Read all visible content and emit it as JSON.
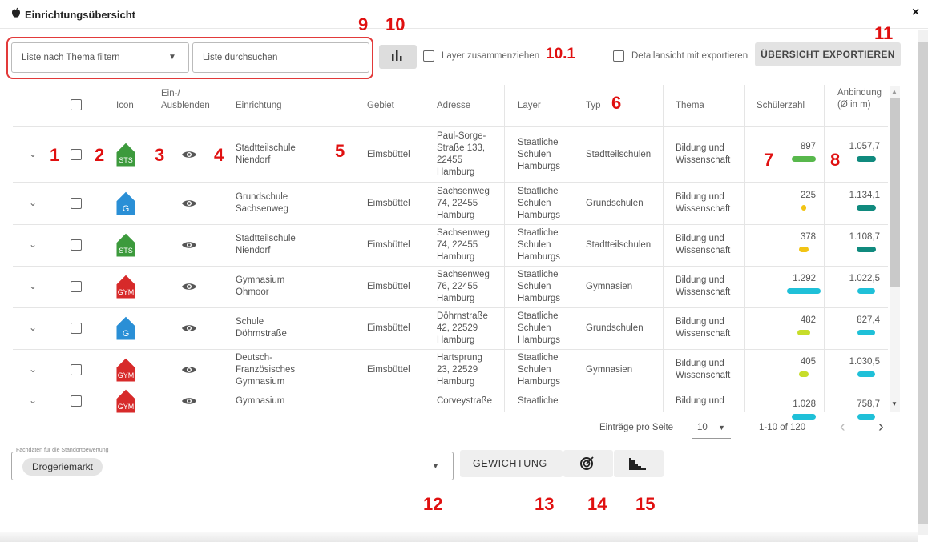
{
  "window": {
    "title": "Einrichtungsübersicht",
    "close_label": "×"
  },
  "toolbar": {
    "filter_placeholder": "Liste nach Thema filtern",
    "search_placeholder": "Liste durchsuchen",
    "merge_layers_label": "Layer zusammenziehen",
    "detail_export_label": "Detailansicht mit exportieren",
    "export_button": "ÜBERSICHT EXPORTIEREN"
  },
  "annotations": [
    "1",
    "2",
    "3",
    "4",
    "5",
    "6",
    "7",
    "8",
    "9",
    "10",
    "10.1",
    "11",
    "12",
    "13",
    "14",
    "15"
  ],
  "table": {
    "headers": {
      "icon": "Icon",
      "toggle": [
        "Ein-/",
        "Ausblenden"
      ],
      "facility": "Einrichtung",
      "area": "Gebiet",
      "address": "Adresse",
      "layer": "Layer",
      "type": "Typ",
      "topic": "Thema",
      "students": "Schülerzahl",
      "connection": [
        "Anbindung",
        "(Ø in m)"
      ]
    },
    "rows": [
      {
        "badge": "STS",
        "badge_color": "#3c9a3c",
        "name": [
          "Stadtteilschule",
          "Niendorf"
        ],
        "area": "Eimsbüttel",
        "address": [
          "Paul-Sorge-",
          "Straße 133,",
          "22455",
          "Hamburg"
        ],
        "layer": [
          "Staatliche",
          "Schulen",
          "Hamburgs"
        ],
        "type": "Stadtteilschulen",
        "topic": [
          "Bildung und",
          "Wissenschaft"
        ],
        "students": "897",
        "students_color": "#58b84c",
        "students_width": 30,
        "connection": "1.057,7",
        "connection_color": "#108a7e",
        "connection_width": 24
      },
      {
        "badge": "G",
        "badge_color": "#2a8fd6",
        "name": [
          "Grundschule",
          "Sachsenweg"
        ],
        "area": "Eimsbüttel",
        "address": [
          "Sachsenweg",
          "74, 22455",
          "Hamburg"
        ],
        "layer": [
          "Staatliche",
          "Schulen",
          "Hamburgs"
        ],
        "type": "Grundschulen",
        "topic": [
          "Bildung und",
          "Wissenschaft"
        ],
        "students": "225",
        "students_color": "#f2c414",
        "students_width": 6,
        "connection": "1.134,1",
        "connection_color": "#108a7e",
        "connection_width": 24
      },
      {
        "badge": "STS",
        "badge_color": "#3c9a3c",
        "name": [
          "Stadtteilschule",
          "Niendorf"
        ],
        "area": "Eimsbüttel",
        "address": [
          "Sachsenweg",
          "74, 22455",
          "Hamburg"
        ],
        "layer": [
          "Staatliche",
          "Schulen",
          "Hamburgs"
        ],
        "type": "Stadtteilschulen",
        "topic": [
          "Bildung und",
          "Wissenschaft"
        ],
        "students": "378",
        "students_color": "#f2c414",
        "students_width": 12,
        "connection": "1.108,7",
        "connection_color": "#108a7e",
        "connection_width": 24
      },
      {
        "badge": "GYM",
        "badge_color": "#d72a2a",
        "name": [
          "Gymnasium",
          "Ohmoor"
        ],
        "area": "Eimsbüttel",
        "address": [
          "Sachsenweg",
          "76, 22455",
          "Hamburg"
        ],
        "layer": [
          "Staatliche",
          "Schulen",
          "Hamburgs"
        ],
        "type": "Gymnasien",
        "topic": [
          "Bildung und",
          "Wissenschaft"
        ],
        "students": "1.292",
        "students_color": "#1fc0d8",
        "students_width": 42,
        "connection": "1.022,5",
        "connection_color": "#1fc0d8",
        "connection_width": 22
      },
      {
        "badge": "G",
        "badge_color": "#2a8fd6",
        "name": [
          "Schule",
          "Döhrnstraße"
        ],
        "area": "Eimsbüttel",
        "address": [
          "Döhrnstraße",
          "42, 22529",
          "Hamburg"
        ],
        "layer": [
          "Staatliche",
          "Schulen",
          "Hamburgs"
        ],
        "type": "Grundschulen",
        "topic": [
          "Bildung und",
          "Wissenschaft"
        ],
        "students": "482",
        "students_color": "#c7dd2a",
        "students_width": 16,
        "connection": "827,4",
        "connection_color": "#1fc0d8",
        "connection_width": 22
      },
      {
        "badge": "GYM",
        "badge_color": "#d72a2a",
        "name": [
          "Deutsch-",
          "Französisches",
          "Gymnasium"
        ],
        "area": "Eimsbüttel",
        "address": [
          "Hartsprung",
          "23, 22529",
          "Hamburg"
        ],
        "layer": [
          "Staatliche",
          "Schulen",
          "Hamburgs"
        ],
        "type": "Gymnasien",
        "topic": [
          "Bildung und",
          "Wissenschaft"
        ],
        "students": "405",
        "students_color": "#c7dd2a",
        "students_width": 12,
        "connection": "1.030,5",
        "connection_color": "#1fc0d8",
        "connection_width": 22
      },
      {
        "badge": "GYM",
        "badge_color": "#d72a2a",
        "name": [
          "Gymnasium"
        ],
        "area": "",
        "address": [
          "Corveystraße"
        ],
        "layer": [
          "Staatliche"
        ],
        "type": "",
        "topic": [
          "Bildung und"
        ],
        "students": "1.028",
        "students_color": "#1fc0d8",
        "students_width": 30,
        "connection": "758,7",
        "connection_color": "#1fc0d8",
        "connection_width": 22
      }
    ]
  },
  "pagination": {
    "per_page_label": "Einträge pro Seite",
    "per_page": "10",
    "range": "1-10 of 120",
    "prev": "‹",
    "next": "›"
  },
  "bottom": {
    "fachdaten_label": "Fachdaten für die Standortbewertung",
    "selected_chip": "Drogeriemarkt",
    "weighting_button": "GEWICHTUNG"
  }
}
